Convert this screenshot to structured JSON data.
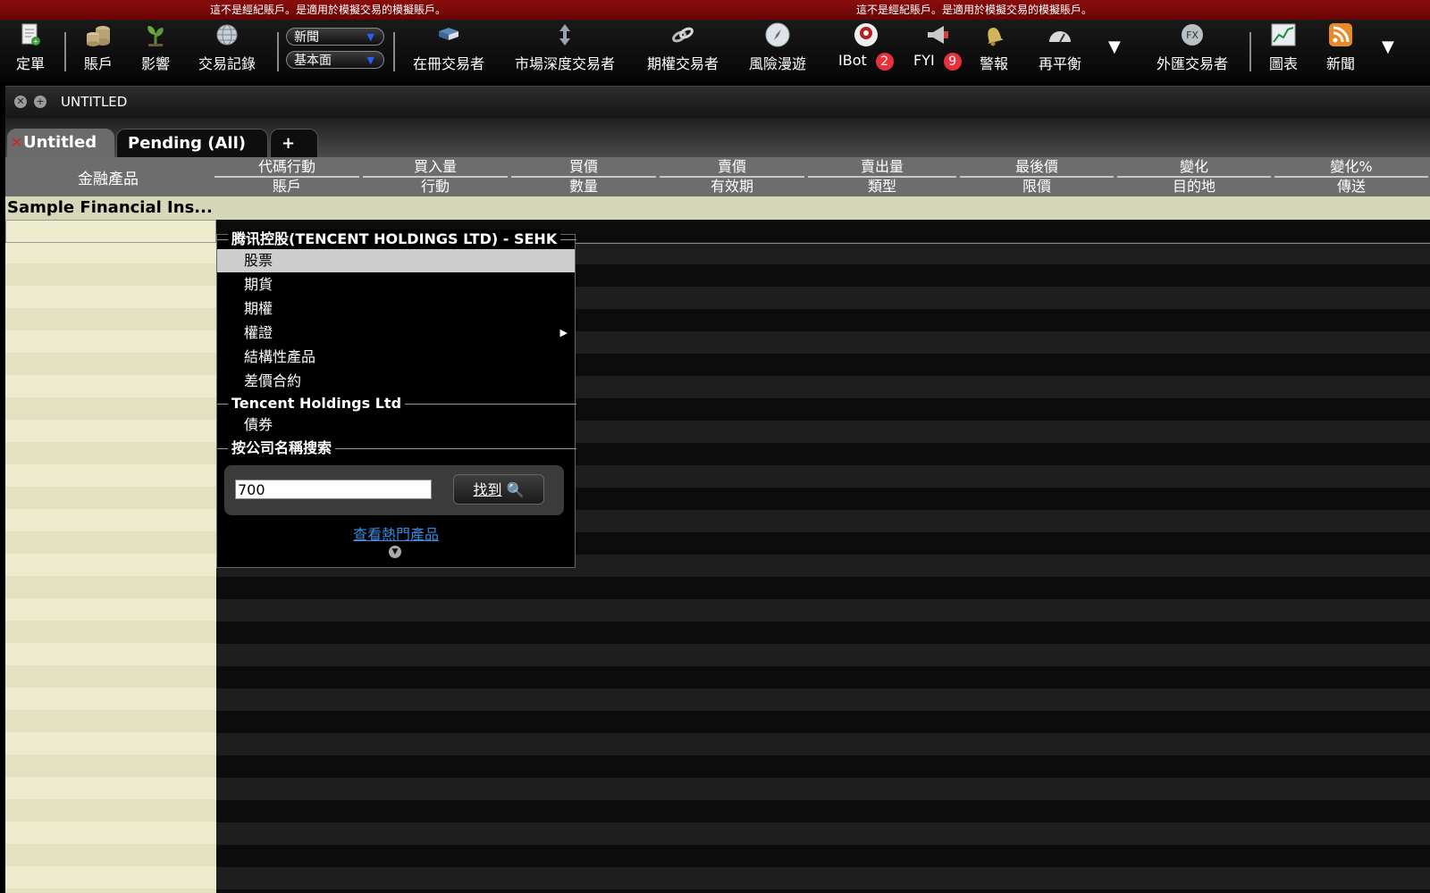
{
  "banner": {
    "left": "這不是經紀賬戶。是適用於模擬交易的模擬賬戶。",
    "right": "這不是經紀賬戶。是適用於模擬交易的模擬賬戶。",
    "color": "#7a0909"
  },
  "toolbar": {
    "order": "定單",
    "account": "賬戶",
    "impact": "影響",
    "trades": "交易記錄",
    "news_dropdown": "新聞",
    "fundamentals_dropdown": "基本面",
    "booktrader": "在冊交易者",
    "depth_trader": "市場深度交易者",
    "options_trader": "期權交易者",
    "risk_navigator": "風險漫遊",
    "ibot": "IBot",
    "ibot_count": "2",
    "fyi": "FYI",
    "fyi_count": "9",
    "alerts": "警報",
    "rebalance": "再平衡",
    "fx_trader": "外匯交易者",
    "charts": "圖表",
    "news": "新聞",
    "more_1": "▼",
    "more_2": "▼",
    "badge_color": "#e8303a"
  },
  "window": {
    "title": "UNTITLED",
    "close_glyph": "✕",
    "expand_glyph": "+"
  },
  "tabs": {
    "active": "Untitled",
    "active_close": "✕",
    "pending": "Pending (All)",
    "add": "+"
  },
  "columns": {
    "instrument": "金融產品",
    "groups": [
      {
        "top": "代碼行動",
        "bottom": "賬戶"
      },
      {
        "top": "買入量",
        "bottom": "行動"
      },
      {
        "top": "買價",
        "bottom": "數量"
      },
      {
        "top": "賣價",
        "bottom": "有效期"
      },
      {
        "top": "賣出量",
        "bottom": "類型"
      },
      {
        "top": "最後價",
        "bottom": "限價"
      },
      {
        "top": "變化",
        "bottom": "目的地"
      },
      {
        "top": "變化%",
        "bottom": "傳送"
      }
    ]
  },
  "grid": {
    "first_row": "Sample Financial Ins..."
  },
  "popup": {
    "section1": "腾讯控股(TENCENT HOLDINGS LTD) - SEHK",
    "items": [
      "股票",
      "期貨",
      "期權",
      "權證",
      "結構性產品",
      "差價合約"
    ],
    "submenu_arrow": "▶",
    "section2": "Tencent Holdings Ltd",
    "bond": "債券",
    "section3": "按公司名稱搜索",
    "search_value": "700",
    "find_label": "找到",
    "find_icon": "🔍",
    "hot_link": "查看熱門產品",
    "more_glyph": "▼",
    "link_color": "#3a8ae0"
  }
}
